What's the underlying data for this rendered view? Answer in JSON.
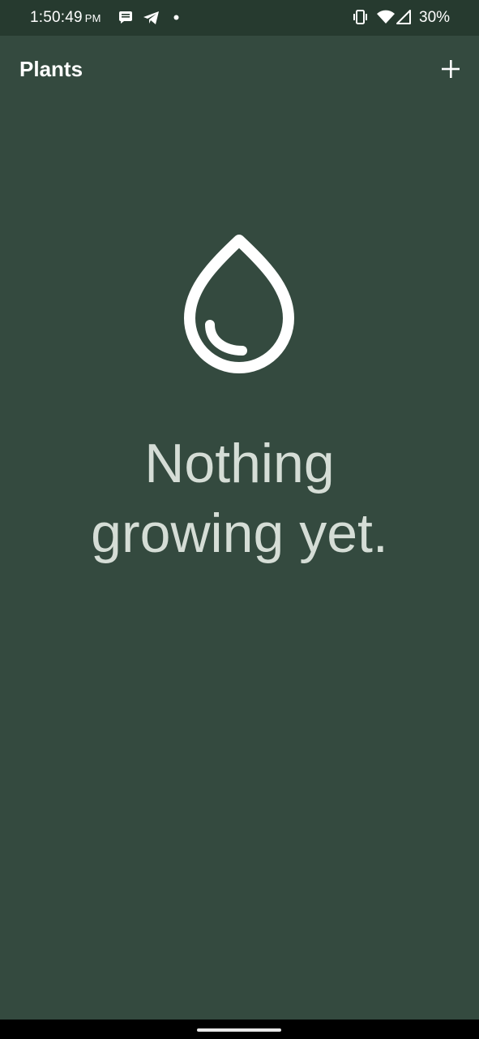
{
  "status_bar": {
    "time": "1:50:49",
    "ampm": "PM",
    "battery": "30%",
    "icons": [
      "message-icon",
      "telegram-icon",
      "notification-dot-icon",
      "vibrate-icon",
      "wifi-icon",
      "signal-icon"
    ]
  },
  "app_bar": {
    "title": "Plants",
    "add_icon": "plus-icon"
  },
  "empty_state": {
    "icon": "water-drop-icon",
    "line1": "Nothing",
    "line2": "growing yet."
  },
  "colors": {
    "background": "#344a3f",
    "status_bar": "#263a2f",
    "empty_text": "#d5ddd6",
    "icon": "#ffffff"
  }
}
